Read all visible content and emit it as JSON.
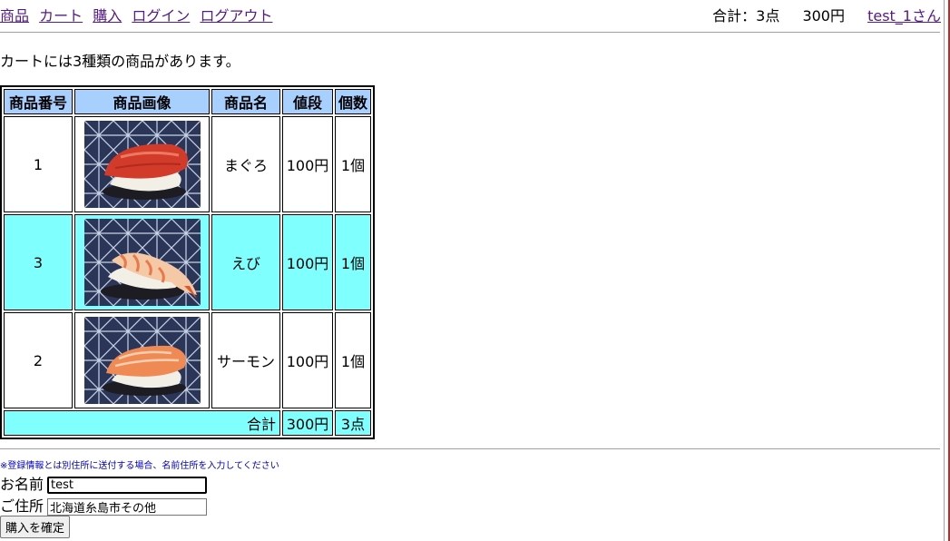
{
  "nav": {
    "items": [
      "商品",
      "カート",
      "購入",
      "ログイン",
      "ログアウト"
    ]
  },
  "header": {
    "summary_label": "合計：3点",
    "summary_price": "300円",
    "user_link": "test_1さん"
  },
  "cart": {
    "message": "カートには3種類の商品があります。",
    "columns": [
      "商品番号",
      "商品画像",
      "商品名",
      "値段",
      "個数"
    ],
    "rows": [
      {
        "number": "1",
        "name": "まぐろ",
        "price": "100円",
        "qty": "1個",
        "image": "maguro-sushi-image",
        "highlight": false
      },
      {
        "number": "3",
        "name": "えび",
        "price": "100円",
        "qty": "1個",
        "image": "ebi-sushi-image",
        "highlight": true
      },
      {
        "number": "2",
        "name": "サーモン",
        "price": "100円",
        "qty": "1個",
        "image": "salmon-sushi-image",
        "highlight": false
      }
    ],
    "total_label": "合計",
    "total_price": "300円",
    "total_qty": "3点"
  },
  "form": {
    "note": "※登録情報とは別住所に送付する場合、名前住所を入力してください",
    "name_label": "お名前",
    "name_value": "test",
    "address_label": "ご住所",
    "address_value": "北海道糸島市その他",
    "submit_label": "購入を確定"
  },
  "colors": {
    "header_bg": "#a8d0ff",
    "highlight_bg": "#80ffff",
    "link": "#551a8b",
    "note": "#0000cc"
  }
}
